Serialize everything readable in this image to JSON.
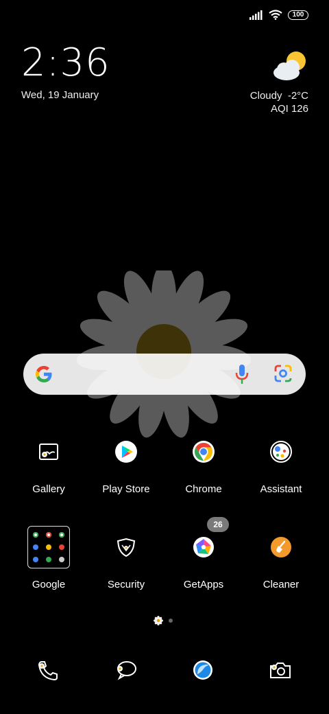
{
  "status_bar": {
    "battery_level": "100",
    "icons": [
      "signal-icon",
      "wifi-icon",
      "battery-icon"
    ]
  },
  "clock": {
    "time": "2:36",
    "date": "Wed, 19 January"
  },
  "weather": {
    "condition": "Cloudy",
    "temperature": "-2°C",
    "aqi": "AQI 126",
    "icon": "partly-cloudy-icon"
  },
  "search_bar": {
    "icons": [
      "google-g-icon",
      "microphone-icon",
      "google-lens-icon"
    ]
  },
  "apps": [
    {
      "label": "Gallery",
      "icon": "gallery-icon"
    },
    {
      "label": "Play Store",
      "icon": "play-store-icon"
    },
    {
      "label": "Chrome",
      "icon": "chrome-icon"
    },
    {
      "label": "Assistant",
      "icon": "assistant-icon"
    },
    {
      "label": "Google",
      "icon": "google-folder-icon"
    },
    {
      "label": "Security",
      "icon": "security-shield-icon"
    },
    {
      "label": "GetApps",
      "icon": "getapps-icon",
      "badge": "26"
    },
    {
      "label": "Cleaner",
      "icon": "cleaner-broom-icon"
    }
  ],
  "page_indicator": {
    "pages": 2,
    "current": 1
  },
  "dock": [
    {
      "icon": "phone-icon"
    },
    {
      "icon": "messages-icon"
    },
    {
      "icon": "browser-icon"
    },
    {
      "icon": "camera-icon"
    }
  ],
  "colors": {
    "background": "#000000",
    "google_blue": "#4285F4",
    "google_red": "#EA4335",
    "google_yellow": "#FBBC05",
    "google_green": "#34A853",
    "cleaner_orange": "#F39A2C",
    "sun_yellow": "#F9C533"
  }
}
